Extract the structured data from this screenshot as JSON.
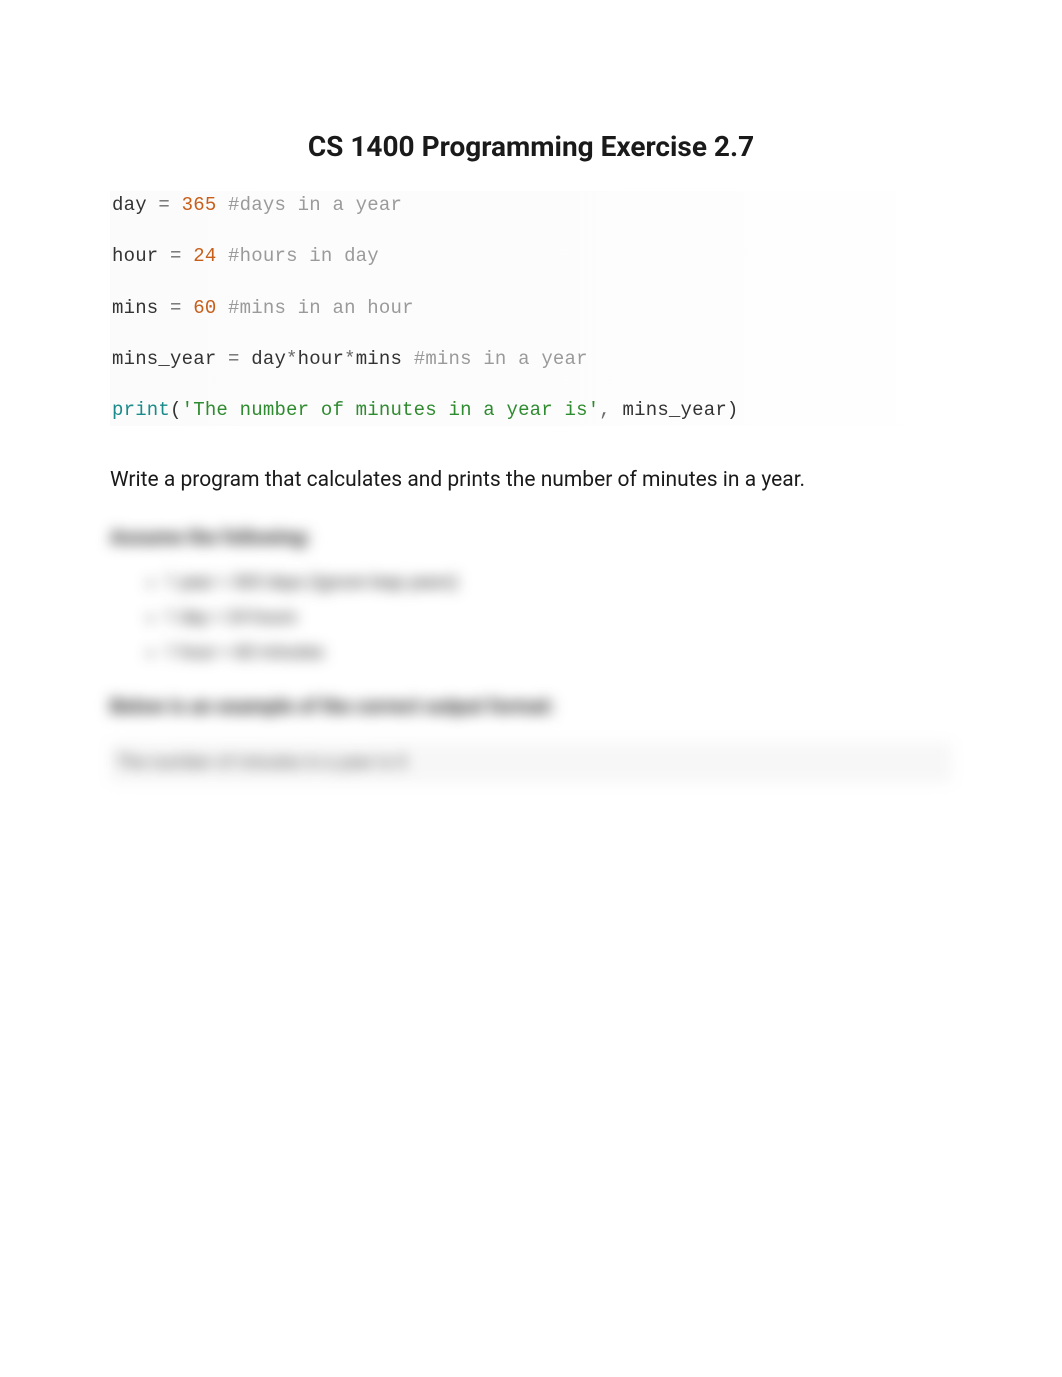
{
  "title": "CS 1400 Programming Exercise 2.7",
  "code": {
    "line1": {
      "var": "day",
      "eq": " = ",
      "num": "365",
      "comment": " #days in a year"
    },
    "line2": {
      "var": "hour",
      "eq": " = ",
      "num": "24",
      "comment": " #hours in day"
    },
    "line3": {
      "var": "mins",
      "eq": " = ",
      "num": "60",
      "comment": " #mins in an hour"
    },
    "line4": {
      "var": "mins_year",
      "eq": " = ",
      "expr1": "day",
      "star1": "*",
      "expr2": "hour",
      "star2": "*",
      "expr3": "mins",
      "comment": " #mins in a year"
    },
    "line5": {
      "func": "print",
      "open": "(",
      "str": "'The number of minutes in a year is'",
      "comma": ",",
      "rest": " mins_year)"
    }
  },
  "instruction": "Write a program that calculates and prints the number of minutes in a year.",
  "blurred": {
    "heading1": "Assume the following:",
    "item1": "1 year = 365 days (Ignore leap years)",
    "item2": "1 day = 24 hours",
    "item3": "1 hour = 60 minutes",
    "heading2": "Below is an example of the correct output format:",
    "output": "The number of minutes in a year is X"
  }
}
